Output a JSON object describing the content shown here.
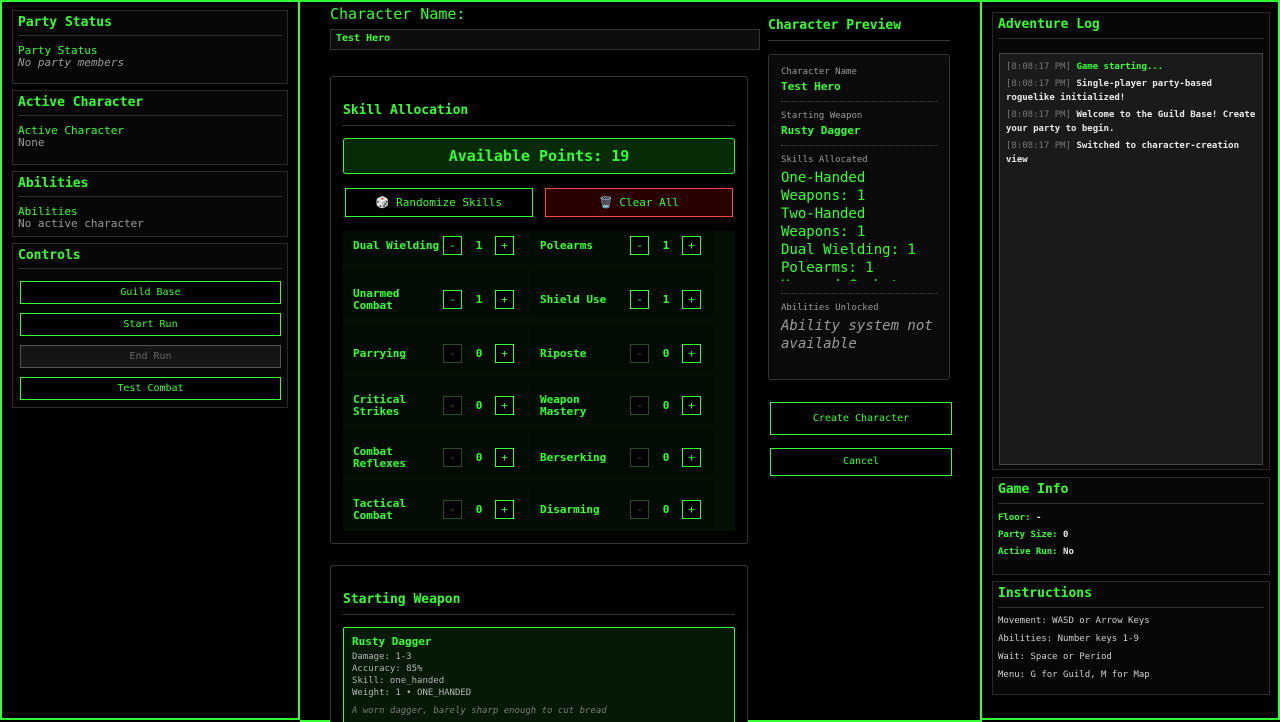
{
  "left": {
    "party_status": {
      "title": "Party Status",
      "label": "Party Status",
      "value": "No party members"
    },
    "active_character": {
      "title": "Active Character",
      "label": "Active Character",
      "value": "None"
    },
    "abilities": {
      "title": "Abilities",
      "label": "Abilities",
      "value": "No active character"
    },
    "controls": {
      "title": "Controls",
      "buttons": [
        "Guild Base",
        "Start Run",
        "End Run",
        "Test Combat"
      ]
    }
  },
  "creation": {
    "name_label": "Character Name:",
    "name_value": "Test Hero",
    "skills": {
      "title": "Skill Allocation",
      "available_points": "Available Points: 19",
      "randomize": "🎲 Randomize Skills",
      "clear": "🗑️ Clear All",
      "items": [
        {
          "name": "Dual Wielding",
          "value": "1"
        },
        {
          "name": "Polearms",
          "value": "1"
        },
        {
          "name": "Unarmed Combat",
          "value": "1"
        },
        {
          "name": "Shield Use",
          "value": "1"
        },
        {
          "name": "Parrying",
          "value": "0"
        },
        {
          "name": "Riposte",
          "value": "0"
        },
        {
          "name": "Critical Strikes",
          "value": "0"
        },
        {
          "name": "Weapon Mastery",
          "value": "0"
        },
        {
          "name": "Combat Reflexes",
          "value": "0"
        },
        {
          "name": "Berserking",
          "value": "0"
        },
        {
          "name": "Tactical Combat",
          "value": "0"
        },
        {
          "name": "Disarming",
          "value": "0"
        }
      ]
    },
    "weapon": {
      "title": "Starting Weapon",
      "name": "Rusty Dagger",
      "damage": "Damage: 1-3",
      "accuracy": "Accuracy: 85%",
      "skill": "Skill: one_handed",
      "weight": "Weight: 1 • ONE_HANDED",
      "description": "A worn dagger, barely sharp enough to cut bread"
    }
  },
  "preview": {
    "title": "Character Preview",
    "name_label": "Character Name",
    "name_value": "Test Hero",
    "weapon_label": "Starting Weapon",
    "weapon_value": "Rusty Dagger",
    "skills_label": "Skills Allocated",
    "skills_list": [
      "One-Handed Weapons: 1",
      "Two-Handed Weapons: 1",
      "Dual Wielding: 1",
      "Polearms: 1",
      "Unarmed Combat:"
    ],
    "abilities_label": "Abilities Unlocked",
    "abilities_value": "Ability system not available",
    "create_button": "Create Character",
    "cancel_button": "Cancel"
  },
  "right": {
    "log": {
      "title": "Adventure Log",
      "entries": [
        {
          "time": "[8:08:17 PM]",
          "text": "Game starting...",
          "color": "#33ff33"
        },
        {
          "time": "[8:08:17 PM]",
          "text": "Single-player party-based roguelike initialized!",
          "color": "#e8e8e8"
        },
        {
          "time": "[8:08:17 PM]",
          "text": "Welcome to the Guild Base! Create your party to begin.",
          "color": "#e8e8e8"
        },
        {
          "time": "[8:08:17 PM]",
          "text": "Switched to character-creation view",
          "color": "#e8e8e8"
        }
      ]
    },
    "game_info": {
      "title": "Game Info",
      "floor_label": "Floor:",
      "floor_value": "-",
      "party_label": "Party Size:",
      "party_value": "0",
      "run_label": "Active Run:",
      "run_value": "No"
    },
    "instructions": {
      "title": "Instructions",
      "lines": [
        "Movement: WASD or Arrow Keys",
        "Abilities: Number keys 1-9",
        "Wait: Space or Period",
        "Menu: G for Guild, M for Map"
      ]
    }
  },
  "colors": {
    "accent": "#33ff33",
    "danger_border": "#ff4444",
    "background": "#000000"
  }
}
